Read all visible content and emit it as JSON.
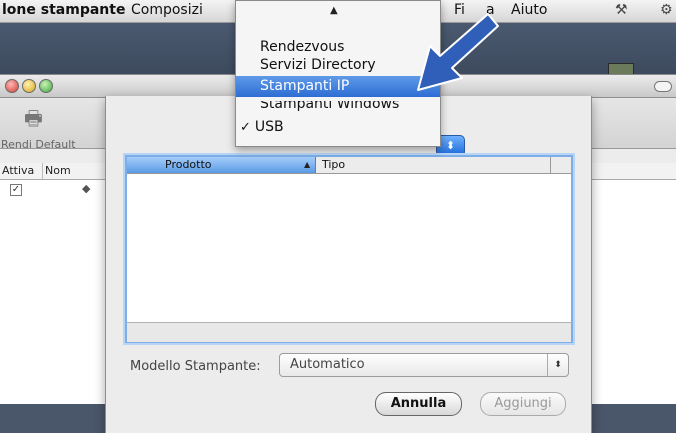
{
  "menubar": {
    "app_name": "lone stampante",
    "items": [
      "Composizi",
      "Fi",
      "a",
      "Aiuto"
    ]
  },
  "window": {
    "toolbar": {
      "make_default_label": "Rendi Default"
    },
    "list_header": {
      "active": "Attiva",
      "name": "Nom"
    },
    "row": {
      "checked": "✓"
    }
  },
  "dropdown": {
    "up_arrow": "▲",
    "items": [
      {
        "label": "Rendezvous"
      },
      {
        "label": "Servizi Directory"
      },
      {
        "label": "Stampanti IP",
        "selected": true
      },
      {
        "label": "Stampanti Windows"
      },
      {
        "label": "USB",
        "checked": true
      }
    ],
    "check_mark": "✓"
  },
  "sheet": {
    "popup_arrows": "⬍",
    "table": {
      "columns": [
        "Prodotto",
        "Tipo"
      ],
      "sort_indicator": "▲",
      "rows": []
    },
    "model_label": "Modello Stampante:",
    "model_value": "Automatico",
    "select_arrows": "⬍",
    "buttons": {
      "cancel": "Annulla",
      "add": "Aggiungi"
    }
  },
  "colors": {
    "highlight": "#3a78d8",
    "callout_arrow": "#2f5fb8",
    "focus_ring": "#7daee8"
  }
}
